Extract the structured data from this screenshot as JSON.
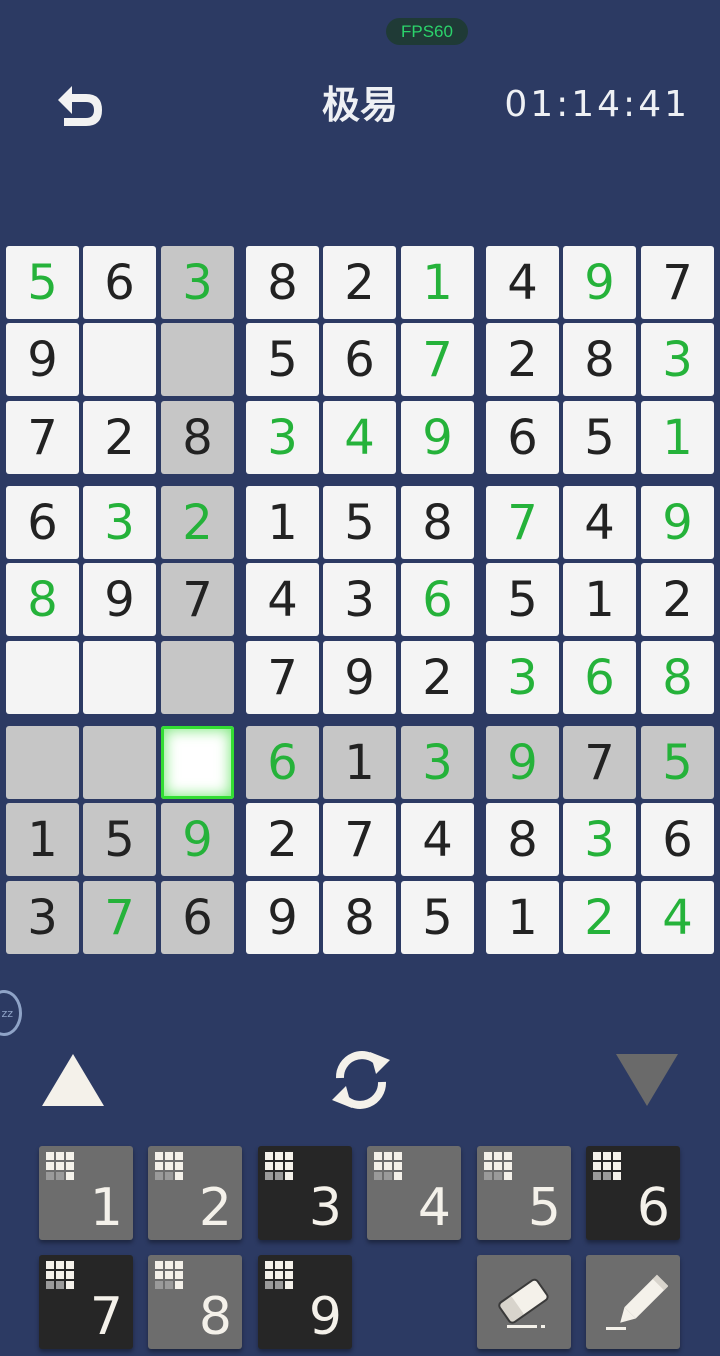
{
  "status": {
    "fps": "FPS60"
  },
  "header": {
    "title": "极易",
    "timer": "01:14:41"
  },
  "side_tab": {
    "label": "zz"
  },
  "board": {
    "rows": [
      [
        "5",
        "6",
        "3",
        "8",
        "2",
        "1",
        "4",
        "9",
        "7"
      ],
      [
        "9",
        "",
        "",
        "5",
        "6",
        "7",
        "2",
        "8",
        "3"
      ],
      [
        "7",
        "2",
        "8",
        "3",
        "4",
        "9",
        "6",
        "5",
        "1"
      ],
      [
        "6",
        "3",
        "2",
        "1",
        "5",
        "8",
        "7",
        "4",
        "9"
      ],
      [
        "8",
        "9",
        "7",
        "4",
        "3",
        "6",
        "5",
        "1",
        "2"
      ],
      [
        "",
        "",
        "",
        "7",
        "9",
        "2",
        "3",
        "6",
        "8"
      ],
      [
        "",
        "",
        "",
        "6",
        "1",
        "3",
        "9",
        "7",
        "5"
      ],
      [
        "1",
        "5",
        "9",
        "2",
        "7",
        "4",
        "8",
        "3",
        "6"
      ],
      [
        "3",
        "7",
        "6",
        "9",
        "8",
        "5",
        "1",
        "2",
        "4"
      ]
    ],
    "user_entered": [
      "0,0",
      "0,2",
      "0,5",
      "0,7",
      "1,5",
      "1,8",
      "2,3",
      "2,4",
      "2,5",
      "2,8",
      "3,1",
      "3,2",
      "3,6",
      "3,8",
      "4,0",
      "4,5",
      "5,6",
      "5,7",
      "5,8",
      "6,3",
      "6,5",
      "6,6",
      "6,8",
      "7,2",
      "7,7",
      "8,1",
      "8,7",
      "8,8"
    ],
    "highlighted": [
      "0,2",
      "1,2",
      "2,2",
      "3,2",
      "4,2",
      "5,2",
      "6,0",
      "6,1",
      "6,3",
      "6,4",
      "6,5",
      "6,6",
      "6,7",
      "6,8",
      "7,0",
      "7,1",
      "7,2",
      "8,0",
      "8,1",
      "8,2"
    ],
    "selected": "6,2"
  },
  "controls": {
    "up": "triangle-up-icon",
    "rotate": "rotate-icon",
    "down": "triangle-down-icon"
  },
  "keypad": {
    "keys": [
      {
        "digit": "1",
        "style": "light"
      },
      {
        "digit": "2",
        "style": "light"
      },
      {
        "digit": "3",
        "style": "dark"
      },
      {
        "digit": "4",
        "style": "light"
      },
      {
        "digit": "5",
        "style": "light"
      },
      {
        "digit": "6",
        "style": "dark"
      },
      {
        "digit": "7",
        "style": "dark"
      },
      {
        "digit": "8",
        "style": "light"
      },
      {
        "digit": "9",
        "style": "dark"
      }
    ],
    "tools": [
      "eraser-icon",
      "pencil-icon"
    ]
  },
  "colors": {
    "background": "#2c3a63",
    "given_digit": "#222222",
    "user_digit": "#25b23a",
    "highlight_cell": "#c6c6c6",
    "selected_glow": "#33dd33"
  }
}
